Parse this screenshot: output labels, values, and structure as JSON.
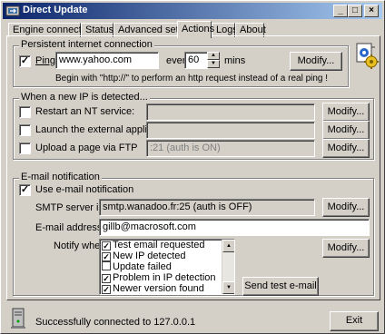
{
  "window": {
    "title": "Direct Update"
  },
  "titlebar_buttons": {
    "minimize": "_",
    "maximize": "□",
    "close": "×"
  },
  "tabs": [
    {
      "label": "Engine connection"
    },
    {
      "label": "Status"
    },
    {
      "label": "Advanced settings"
    },
    {
      "label": "Actions"
    },
    {
      "label": "Logs"
    },
    {
      "label": "About"
    }
  ],
  "active_tab": "Actions",
  "persistent": {
    "group_label": "Persistent internet connection",
    "ping_label": "Ping",
    "ping_checked": true,
    "url_value": "www.yahoo.com",
    "every_label": "every",
    "interval_value": "60",
    "mins_label": "mins",
    "modify_label": "Modify...",
    "hint": "Begin with \"http://\" to perform an http request instead of a real ping !"
  },
  "ip_detected": {
    "group_label": "When a new IP is detected...",
    "rows": [
      {
        "label": "Restart an NT service:",
        "checked": false,
        "value": "",
        "modify_label": "Modify..."
      },
      {
        "label": "Launch the external application:",
        "checked": false,
        "value": "",
        "modify_label": "Modify..."
      },
      {
        "label": "Upload a page via FTP",
        "checked": false,
        "value": ":21 (auth is ON)",
        "modify_label": "Modify..."
      }
    ]
  },
  "email": {
    "group_label": "E-mail notification",
    "use_label": "Use e-mail notification",
    "use_checked": true,
    "smtp_label": "SMTP server info:",
    "smtp_value": "smtp.wanadoo.fr:25 (auth is OFF)",
    "smtp_modify_label": "Modify...",
    "address_label": "E-mail address(es):",
    "address_value": "gillb@macrosoft.com",
    "notify_label": "Notify when:",
    "notify_items": [
      {
        "label": "Test email requested",
        "checked": true
      },
      {
        "label": "New IP detected",
        "checked": true
      },
      {
        "label": "Update failed",
        "checked": false
      },
      {
        "label": "Problem in IP detection",
        "checked": true
      },
      {
        "label": "Newer version found",
        "checked": true
      }
    ],
    "notify_modify_label": "Modify...",
    "send_test_label": "Send test e-mail"
  },
  "status": {
    "text": "Successfully connected to 127.0.0.1",
    "exit_label": "Exit"
  },
  "icons": {
    "app": "direct-update-icon",
    "settings": "settings-gear-icon",
    "server": "server-tower-icon"
  },
  "colors": {
    "titlebar_start": "#0a246a",
    "titlebar_end": "#a6caf0",
    "face": "#d4d0c8"
  }
}
